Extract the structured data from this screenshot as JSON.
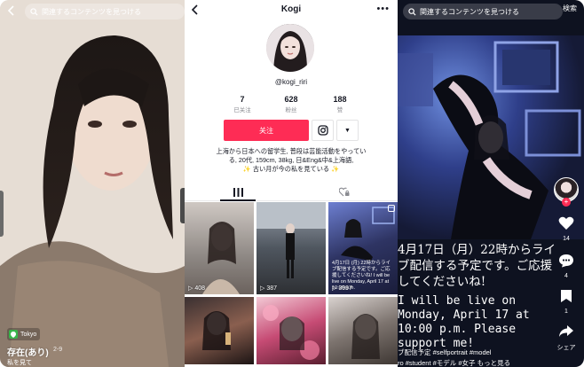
{
  "left": {
    "search_placeholder": "関連するコンテンツを見つける",
    "location": "Tokyo",
    "title": "存在(あり)",
    "date": "2-9",
    "subtitle": "私を見て"
  },
  "profile": {
    "name": "Kogi",
    "more": "•••",
    "handle": "@kogi_riri",
    "stats": [
      {
        "num": "7",
        "label": "已关注"
      },
      {
        "num": "628",
        "label": "粉丝"
      },
      {
        "num": "188",
        "label": "赞"
      }
    ],
    "follow_label": "关注",
    "dropdown": "▼",
    "bio_lines": [
      "上海から日本への留学生, 普段は芸能活動をやってい",
      "る, 20代, 159cm, 38kg, 日&Eng&中&上海語,",
      "✨ 古い月が今の私を見ている ✨"
    ],
    "videos": [
      {
        "views": "408"
      },
      {
        "views": "387"
      },
      {
        "views": "3997",
        "overlay": "4月17日 (月) 22時からライブ配信する予定です。ご応援してくださいね! I will be live on Monday, April 17 at 10:00 p.m."
      },
      {
        "views": ""
      },
      {
        "views": ""
      },
      {
        "views": ""
      }
    ]
  },
  "right": {
    "search_placeholder": "関連するコンテンツを見つける",
    "search_button": "検索",
    "likes": "14",
    "comments": "4",
    "saves": "1",
    "share": "シェア",
    "caption_jp": "4月17日（月）22時からライブ配信する予定です。ご応援してくださいね!",
    "caption_en": "I will be live on Monday, April 17 at 10:00 p.m. Please support me!",
    "tags_line1": "ブ配信予定 #selfportrait #model",
    "tags_line2": "ro #student #モデル #女子   もっと見る"
  }
}
